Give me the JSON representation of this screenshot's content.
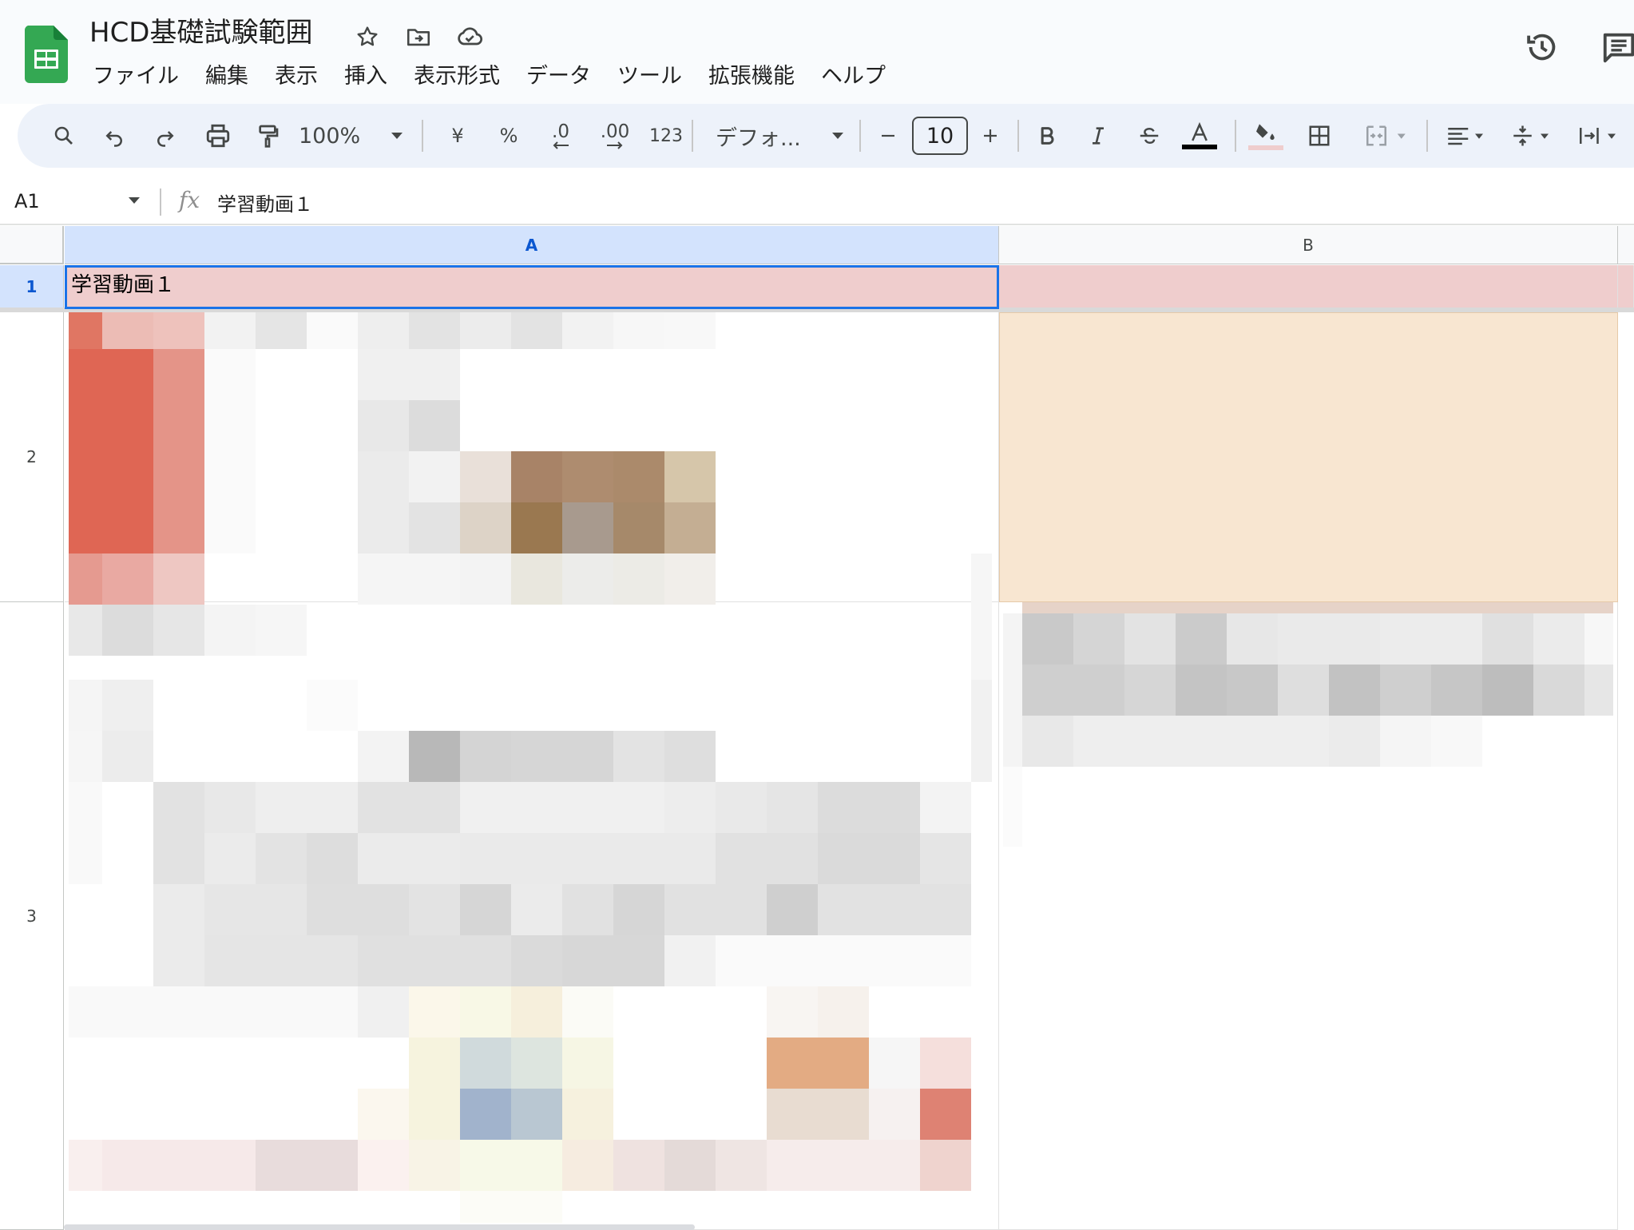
{
  "document": {
    "title": "HCD基礎試験範囲"
  },
  "menu": {
    "items": [
      "ファイル",
      "編集",
      "表示",
      "挿入",
      "表示形式",
      "データ",
      "ツール",
      "拡張機能",
      "ヘルプ"
    ]
  },
  "toolbar": {
    "zoom": "100%",
    "currency": "¥",
    "percent": "%",
    "decrease_decimal": ".0",
    "increase_decimal": ".00",
    "number_format": "123",
    "font": "デフォ...",
    "font_size": "10"
  },
  "formula_bar": {
    "cell_ref": "A1",
    "content": "学習動画１"
  },
  "grid": {
    "columns": [
      "A",
      "B"
    ],
    "rows": [
      "1",
      "2",
      "3"
    ],
    "selected_column": "A",
    "selected_row": "1",
    "cells": {
      "A1": "学習動画１"
    }
  },
  "colors": {
    "sheets_green": "#0f9d58",
    "selection_blue": "#1a73e8",
    "row1_fill": "#efcdcd",
    "b2_fill": "#f8e6d1",
    "header_selected": "#d3e3fd"
  },
  "icons": {
    "title": [
      "star-icon",
      "move-to-folder-icon",
      "cloud-status-icon"
    ],
    "top_right": [
      "version-history-icon",
      "comments-icon"
    ],
    "toolbar": [
      "search-icon",
      "undo-icon",
      "redo-icon",
      "print-icon",
      "paint-format-icon",
      "bold-icon",
      "italic-icon",
      "strikethrough-icon",
      "text-color-icon",
      "fill-color-icon",
      "borders-icon",
      "merge-cells-icon",
      "horizontal-align-icon",
      "vertical-align-icon",
      "text-wrap-icon"
    ]
  }
}
